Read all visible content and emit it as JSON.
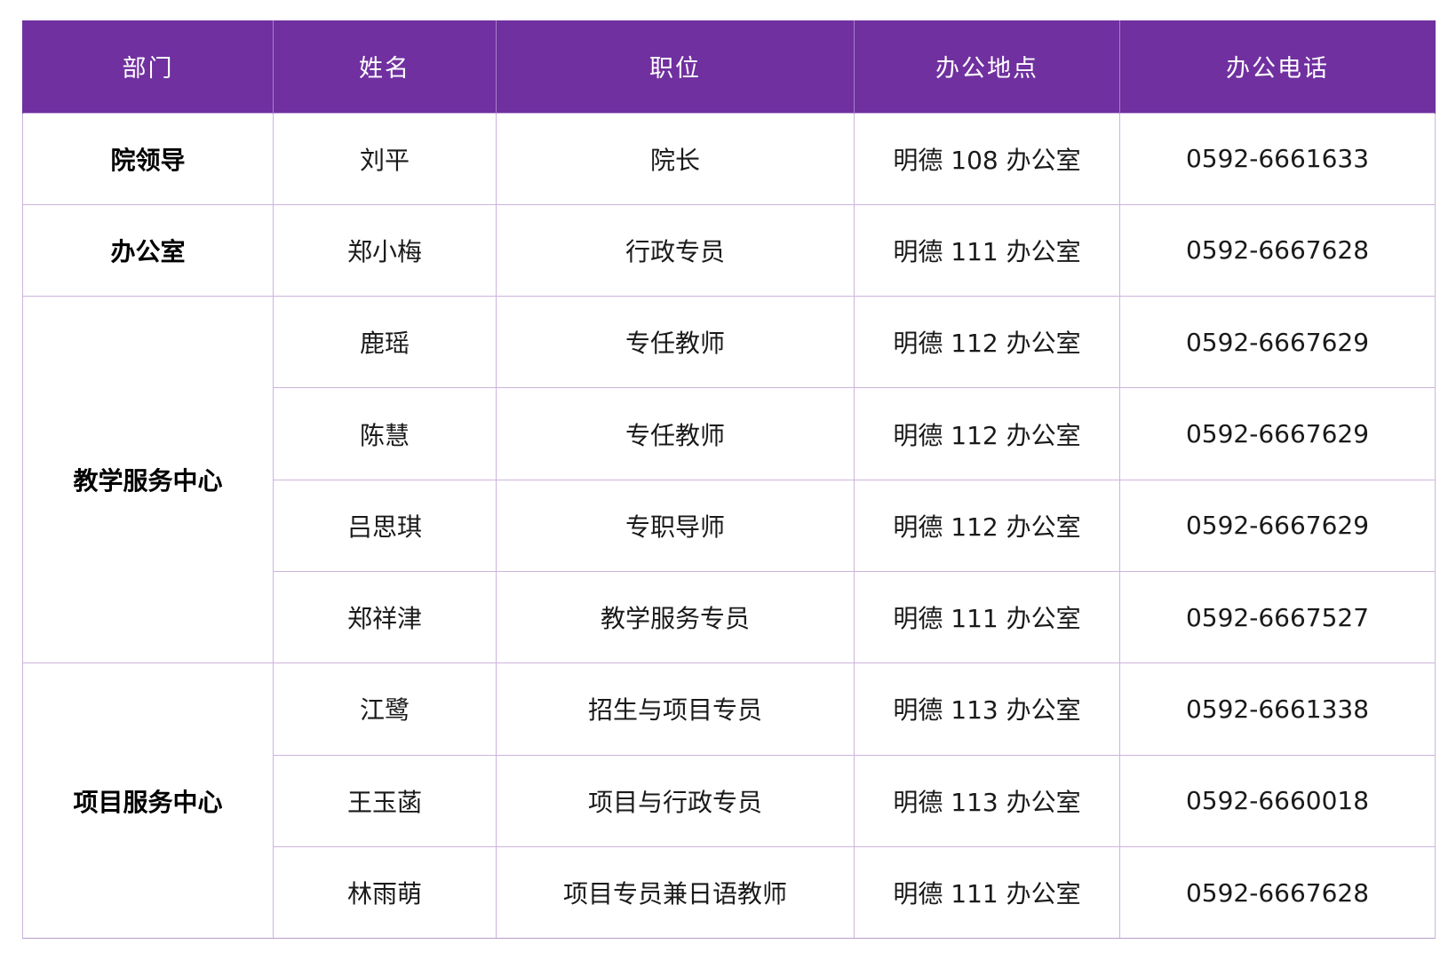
{
  "table": {
    "headers": [
      "部门",
      "姓名",
      "职位",
      "办公地点",
      "办公电话"
    ],
    "groups": [
      {
        "department": "院领导",
        "rows": [
          {
            "name": "刘平",
            "position": "院长",
            "location": "明德 108 办公室",
            "phone": "0592-6661633"
          }
        ]
      },
      {
        "department": "办公室",
        "rows": [
          {
            "name": "郑小梅",
            "position": "行政专员",
            "location": "明德 111 办公室",
            "phone": "0592-6667628"
          }
        ]
      },
      {
        "department": "教学服务中心",
        "rows": [
          {
            "name": "鹿瑶",
            "position": "专任教师",
            "location": "明德 112 办公室",
            "phone": "0592-6667629"
          },
          {
            "name": "陈慧",
            "position": "专任教师",
            "location": "明德 112 办公室",
            "phone": "0592-6667629"
          },
          {
            "name": "吕思琪",
            "position": "专职导师",
            "location": "明德 112 办公室",
            "phone": "0592-6667629"
          },
          {
            "name": "郑祥津",
            "position": "教学服务专员",
            "location": "明德 111 办公室",
            "phone": "0592-6667527"
          }
        ]
      },
      {
        "department": "项目服务中心",
        "rows": [
          {
            "name": "江鹭",
            "position": "招生与项目专员",
            "location": "明德 113 办公室",
            "phone": "0592-6661338"
          },
          {
            "name": "王玉菡",
            "position": "项目与行政专员",
            "location": "明德 113 办公室",
            "phone": "0592-6660018"
          },
          {
            "name": "林雨萌",
            "position": "项目专员兼日语教师",
            "location": "明德 111 办公室",
            "phone": "0592-6667628"
          }
        ]
      }
    ]
  },
  "colors": {
    "header_bg": "#7030a0",
    "header_text": "#ffffff",
    "border": "#cdb4dc"
  }
}
